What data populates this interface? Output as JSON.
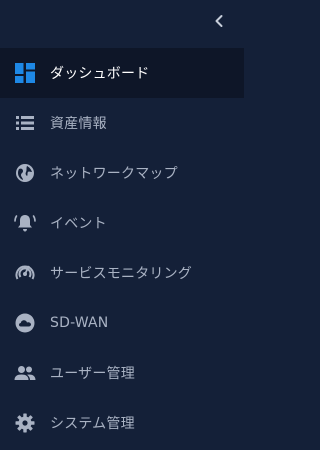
{
  "sidebar": {
    "collapse_icon": "chevron-left-icon",
    "items": [
      {
        "label": "ダッシュボード",
        "icon": "dashboard-icon",
        "active": true
      },
      {
        "label": "資産情報",
        "icon": "list-icon"
      },
      {
        "label": "ネットワークマップ",
        "icon": "globe-icon"
      },
      {
        "label": "イベント",
        "icon": "bell-alert-icon"
      },
      {
        "label": "サービスモニタリング",
        "icon": "radar-icon"
      },
      {
        "label": "SD-WAN",
        "icon": "cloud-icon"
      },
      {
        "label": "ユーザー管理",
        "icon": "users-icon"
      },
      {
        "label": "システム管理",
        "icon": "gear-icon"
      }
    ]
  },
  "colors": {
    "background": "#142038",
    "active_background": "#0e1628",
    "accent": "#1e88e5",
    "text": "#a9b2c3",
    "active_text": "#ffffff"
  }
}
